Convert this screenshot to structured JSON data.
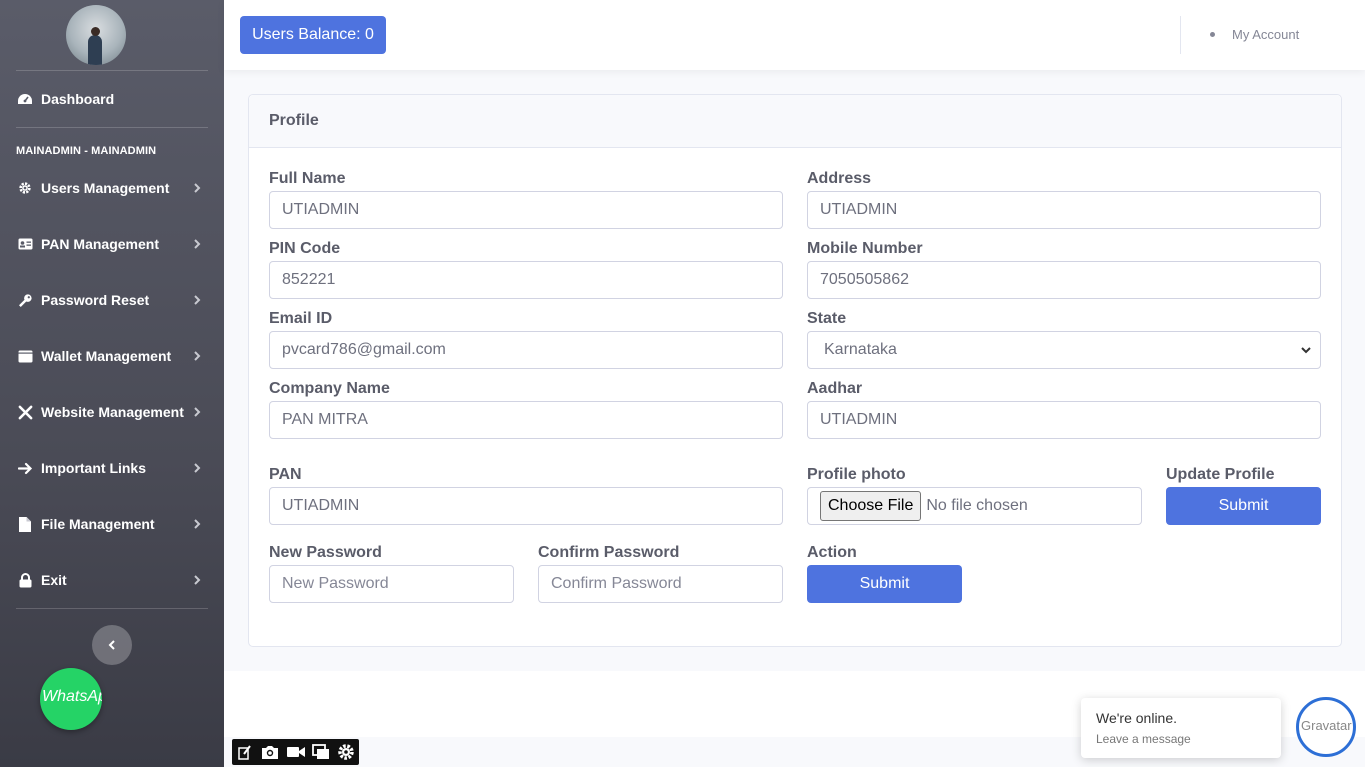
{
  "sidebar": {
    "dashboard": "Dashboard",
    "section_heading": "MAINADMIN - MAINADMIN",
    "items": [
      {
        "label": "Users Management",
        "icon": "gear-icon"
      },
      {
        "label": "PAN Management",
        "icon": "id-card-icon"
      },
      {
        "label": "Password Reset",
        "icon": "key-icon"
      },
      {
        "label": "Wallet Management",
        "icon": "wallet-icon"
      },
      {
        "label": "Website Management",
        "icon": "tools-icon"
      },
      {
        "label": "Important Links",
        "icon": "arrow-right-icon"
      },
      {
        "label": "File Management",
        "icon": "file-icon"
      },
      {
        "label": "Exit",
        "icon": "lock-icon"
      }
    ],
    "whatsapp_alt": "WhatsApp"
  },
  "topbar": {
    "balance": "Users Balance: 0",
    "account": "My Account"
  },
  "profile": {
    "title": "Profile",
    "full_name_label": "Full Name",
    "full_name": "UTIADMIN",
    "address_label": "Address",
    "address": "UTIADMIN",
    "pin_label": "PIN Code",
    "pin": "852221",
    "mobile_label": "Mobile Number",
    "mobile": "7050505862",
    "email_label": "Email ID",
    "email": "pvcard786@gmail.com",
    "state_label": "State",
    "state": "Karnataka",
    "company_label": "Company Name",
    "company": "PAN MITRA",
    "aadhar_label": "Aadhar",
    "aadhar": "UTIADMIN",
    "pan_label": "PAN",
    "pan": "UTIADMIN",
    "photo_label": "Profile photo",
    "choose_file": "Choose File",
    "no_file": "No file chosen",
    "update_label": "Update Profile",
    "submit": "Submit",
    "new_password_label": "New Password",
    "new_password_placeholder": "New Password",
    "confirm_password_label": "Confirm Password",
    "confirm_password_placeholder": "Confirm Password",
    "action_label": "Action",
    "action_submit": "Submit"
  },
  "chat": {
    "status": "We're online.",
    "prompt": "Leave a message",
    "avatar_alt": "Gravatar"
  },
  "colors": {
    "primary": "#4e73df",
    "sidebar": "#5a5c69",
    "whatsapp": "#25d366"
  }
}
